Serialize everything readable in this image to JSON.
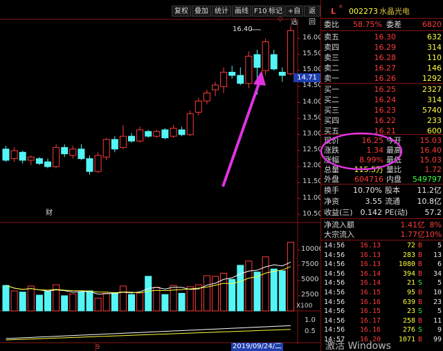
{
  "toolbar": {
    "title": "",
    "buttons": [
      "复权",
      "叠加",
      "统计",
      "画线",
      "F10",
      "标记",
      "+自选",
      "返回"
    ]
  },
  "stock": {
    "flag": "L",
    "code": "002273",
    "name": "水晶光电"
  },
  "header_row": {
    "label1": "委比",
    "value1": "58.75%",
    "label2": "委差",
    "value2": "6820"
  },
  "sells": [
    {
      "label": "卖五",
      "price": "16.30",
      "vol": "632"
    },
    {
      "label": "卖四",
      "price": "16.29",
      "vol": "314"
    },
    {
      "label": "卖三",
      "price": "16.28",
      "vol": "110"
    },
    {
      "label": "卖二",
      "price": "16.27",
      "vol": "146"
    },
    {
      "label": "卖一",
      "price": "16.26",
      "vol": "1292"
    }
  ],
  "buys": [
    {
      "label": "买一",
      "price": "16.25",
      "vol": "2327"
    },
    {
      "label": "买二",
      "price": "16.24",
      "vol": "314"
    },
    {
      "label": "买三",
      "price": "16.23",
      "vol": "5740"
    },
    {
      "label": "买四",
      "price": "16.22",
      "vol": "233"
    },
    {
      "label": "买五",
      "price": "16.21",
      "vol": "600"
    }
  ],
  "quote": [
    {
      "l1": "现价",
      "v1": "16.25",
      "c1": "red",
      "l2": "今开",
      "v2": "15.03",
      "c2": "red"
    },
    {
      "l1": "涨跌",
      "v1": "1.34",
      "c1": "red",
      "l2": "最高",
      "v2": "16.40",
      "c2": "red"
    },
    {
      "l1": "涨幅",
      "v1": "8.99%",
      "c1": "red",
      "l2": "最低",
      "v2": "15.03",
      "c2": "red"
    },
    {
      "l1": "总量",
      "v1": "115.5万",
      "c1": "yellow",
      "l2": "量比",
      "v2": "1.72",
      "c2": "red"
    },
    {
      "l1": "外盘",
      "v1": "604716",
      "c1": "red",
      "l2": "内盘",
      "v2": "549797",
      "c2": "green"
    }
  ],
  "stats": [
    {
      "l1": "换手",
      "v1": "10.70%",
      "l2": "股本",
      "v2": "11.2亿"
    },
    {
      "l1": "净资",
      "v1": "3.55",
      "l2": "流通",
      "v2": "10.8亿"
    },
    {
      "l1": "收益(三)",
      "v1": "0.142",
      "l2": "PE(动)",
      "v2": "57.2"
    }
  ],
  "flows": [
    {
      "label": "净流入额",
      "value": "1.41亿",
      "pct": "8%"
    },
    {
      "label": "大宗流入",
      "value": "1.77亿",
      "pct": "10%"
    }
  ],
  "ticks": [
    {
      "time": "14:56",
      "price": "16.13",
      "vol": "72",
      "side": "B",
      "n": "5"
    },
    {
      "time": "14:56",
      "price": "16.13",
      "vol": "283",
      "side": "B",
      "n": "13"
    },
    {
      "time": "14:56",
      "price": "16.13",
      "vol": "1080",
      "side": "B",
      "n": "6"
    },
    {
      "time": "14:56",
      "price": "16.14",
      "vol": "394",
      "side": "B",
      "n": "34"
    },
    {
      "time": "14:56",
      "price": "16.14",
      "vol": "21",
      "side": "S",
      "n": "5"
    },
    {
      "time": "14:56",
      "price": "16.15",
      "vol": "95",
      "side": "B",
      "n": "10"
    },
    {
      "time": "14:56",
      "price": "16.16",
      "vol": "639",
      "side": "B",
      "n": "23"
    },
    {
      "time": "14:56",
      "price": "16.15",
      "vol": "23",
      "side": "S",
      "n": "5"
    },
    {
      "time": "14:56",
      "price": "16.17",
      "vol": "258",
      "side": "B",
      "n": "11"
    },
    {
      "time": "14:56",
      "price": "16.16",
      "vol": "276",
      "side": "S",
      "n": "9"
    },
    {
      "time": "14:57",
      "price": "16.20",
      "vol": "1071",
      "side": "B",
      "n": "99"
    }
  ],
  "chart_data": {
    "type": "candlestick",
    "price_axis": [
      "16.00",
      "15.50",
      "15.00",
      "14.50",
      "14.00",
      "13.50",
      "13.00",
      "12.50",
      "12.00",
      "11.50",
      "11.00",
      "10.50"
    ],
    "ylim": [
      10.3,
      16.6
    ],
    "current_price_tag": "14.71",
    "high_annotation": "16.40",
    "finance_marker": "财",
    "volume_axis": [
      "10000",
      "7500",
      "5000",
      "2500"
    ],
    "volume_unit": "X100",
    "volume_ylim": [
      0,
      12500
    ],
    "macd_axis": [
      "1.0",
      "0.5"
    ],
    "x_labels": [
      "9",
      "2019/09/24/二"
    ],
    "candles": [
      {
        "o": 12.55,
        "h": 12.65,
        "l": 12.15,
        "c": 12.2
      },
      {
        "o": 12.25,
        "h": 12.6,
        "l": 12.15,
        "c": 12.5
      },
      {
        "o": 12.45,
        "h": 12.5,
        "l": 12.1,
        "c": 12.2
      },
      {
        "o": 12.2,
        "h": 12.35,
        "l": 12.05,
        "c": 12.3
      },
      {
        "o": 12.25,
        "h": 12.3,
        "l": 12.05,
        "c": 12.1
      },
      {
        "o": 12.15,
        "h": 12.25,
        "l": 11.95,
        "c": 12.0
      },
      {
        "o": 12.0,
        "h": 12.7,
        "l": 11.95,
        "c": 12.6
      },
      {
        "o": 12.6,
        "h": 12.7,
        "l": 12.3,
        "c": 12.4
      },
      {
        "o": 12.35,
        "h": 12.65,
        "l": 12.25,
        "c": 12.55
      },
      {
        "o": 12.55,
        "h": 12.7,
        "l": 12.2,
        "c": 12.25
      },
      {
        "o": 12.25,
        "h": 12.35,
        "l": 11.75,
        "c": 11.85
      },
      {
        "o": 11.85,
        "h": 12.45,
        "l": 11.8,
        "c": 12.35
      },
      {
        "o": 12.3,
        "h": 12.9,
        "l": 12.2,
        "c": 12.85
      },
      {
        "o": 12.85,
        "h": 12.95,
        "l": 12.45,
        "c": 12.55
      },
      {
        "o": 12.6,
        "h": 13.3,
        "l": 12.55,
        "c": 12.95
      },
      {
        "o": 12.95,
        "h": 13.05,
        "l": 12.75,
        "c": 12.8
      },
      {
        "o": 12.8,
        "h": 13.25,
        "l": 12.75,
        "c": 13.15
      },
      {
        "o": 13.1,
        "h": 13.15,
        "l": 12.9,
        "c": 12.95
      },
      {
        "o": 12.95,
        "h": 13.15,
        "l": 12.9,
        "c": 13.1
      },
      {
        "o": 13.15,
        "h": 13.2,
        "l": 12.85,
        "c": 12.9
      },
      {
        "o": 12.95,
        "h": 13.3,
        "l": 12.9,
        "c": 13.2
      },
      {
        "o": 13.15,
        "h": 13.25,
        "l": 12.95,
        "c": 13.0
      },
      {
        "o": 13.0,
        "h": 13.75,
        "l": 12.95,
        "c": 13.65
      },
      {
        "o": 13.7,
        "h": 14.15,
        "l": 13.6,
        "c": 14.05
      },
      {
        "o": 14.05,
        "h": 14.4,
        "l": 13.95,
        "c": 14.3
      },
      {
        "o": 14.4,
        "h": 14.65,
        "l": 14.2,
        "c": 14.55
      },
      {
        "o": 14.5,
        "h": 15.1,
        "l": 14.3,
        "c": 14.95
      },
      {
        "o": 14.95,
        "h": 15.15,
        "l": 14.75,
        "c": 14.85
      },
      {
        "o": 14.85,
        "h": 15.1,
        "l": 14.55,
        "c": 14.6
      },
      {
        "o": 14.6,
        "h": 15.6,
        "l": 14.45,
        "c": 15.45
      },
      {
        "o": 15.5,
        "h": 15.65,
        "l": 14.25,
        "c": 15.1
      },
      {
        "o": 15.0,
        "h": 16.0,
        "l": 14.85,
        "c": 15.9
      },
      {
        "o": 15.5,
        "h": 15.65,
        "l": 15.0,
        "c": 15.05
      },
      {
        "o": 14.95,
        "h": 15.1,
        "l": 14.65,
        "c": 14.85
      },
      {
        "o": 14.9,
        "h": 16.4,
        "l": 14.85,
        "c": 16.25
      }
    ],
    "volumes": [
      4200,
      3300,
      3100,
      4100,
      2600,
      3200,
      4300,
      2500,
      2800,
      3100,
      3300,
      2100,
      2900,
      3000,
      4100,
      2700,
      3000,
      5700,
      3900,
      2700,
      4200,
      2900,
      4000,
      4300,
      5800,
      5700,
      6200,
      5200,
      7500,
      8200,
      6400,
      8900,
      6900,
      6600,
      11300
    ]
  }
}
